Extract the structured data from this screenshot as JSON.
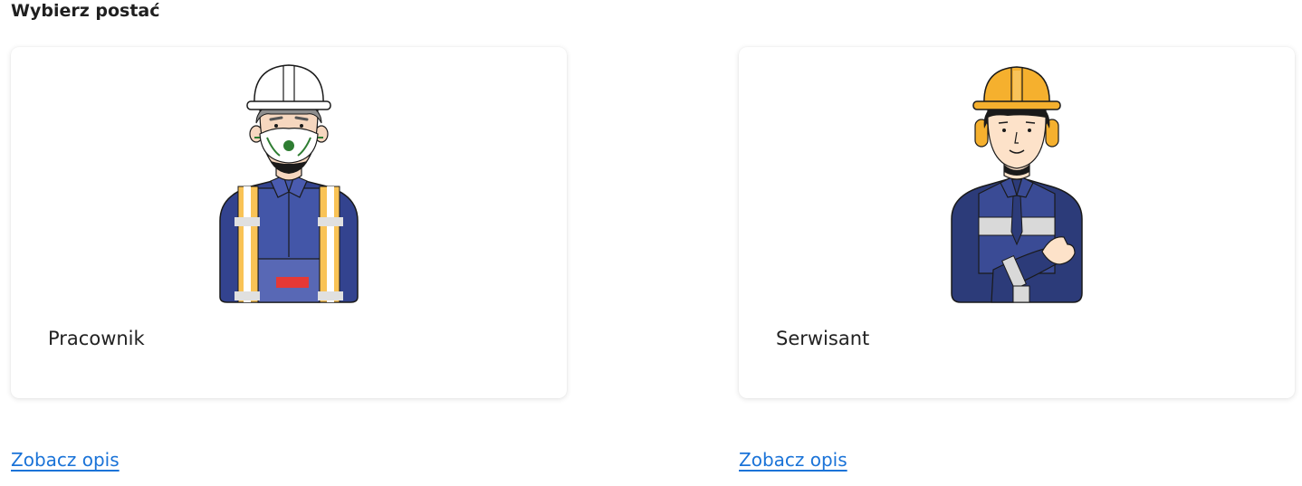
{
  "page": {
    "title": "Wybierz postać"
  },
  "characters": [
    {
      "label": "Pracownik",
      "link": "Zobacz opis",
      "icon": "worker-with-mask-avatar",
      "helmet_color": "#ffffff",
      "vest_color": "#f9c356"
    },
    {
      "label": "Serwisant",
      "link": "Zobacz opis",
      "icon": "service-technician-avatar",
      "helmet_color": "#f5b02e",
      "jacket_color": "#2c3b79"
    }
  ],
  "colors": {
    "link": "#1a73d8",
    "uniform_blue": "#33438f"
  }
}
